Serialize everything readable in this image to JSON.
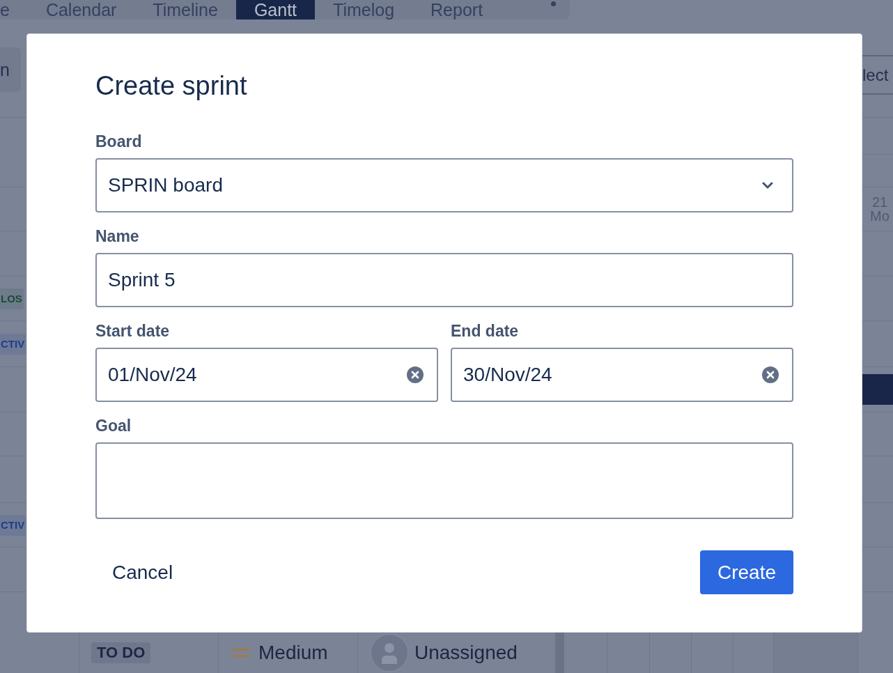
{
  "background": {
    "tabs": [
      {
        "label": "e",
        "selected": false
      },
      {
        "label": "Calendar",
        "selected": false
      },
      {
        "label": "Timeline",
        "selected": false
      },
      {
        "label": "Gantt",
        "selected": true
      },
      {
        "label": "Timelog",
        "selected": false
      },
      {
        "label": "Report",
        "selected": false
      }
    ],
    "left_column": {
      "button": "n",
      "badges": [
        {
          "label": "LOS",
          "color": "#1d4a3a"
        },
        {
          "label": "CTIV",
          "color": "#1c3d8c"
        },
        {
          "label": "CTIV",
          "color": "#1c3d8c"
        }
      ]
    },
    "right_column": {
      "button": "lect",
      "date_header": {
        "day": "21",
        "weekday": "Mo"
      }
    },
    "task_row": {
      "status": "TO DO",
      "priority": "Medium",
      "assignee": "Unassigned"
    }
  },
  "dialog": {
    "title": "Create sprint",
    "fields": [
      {
        "kind": "select",
        "label": "Board",
        "value": "SPRIN board"
      },
      {
        "kind": "text",
        "label": "Name",
        "value": "Sprint 5"
      },
      {
        "kind": "date",
        "label": "Start date",
        "value": "01/Nov/24"
      },
      {
        "kind": "date",
        "label": "End date",
        "value": "30/Nov/24"
      },
      {
        "kind": "textarea",
        "label": "Goal"
      }
    ],
    "buttons": [
      {
        "kind": "subtle",
        "label": "Cancel"
      },
      {
        "kind": "primary",
        "label": "Create"
      }
    ]
  }
}
